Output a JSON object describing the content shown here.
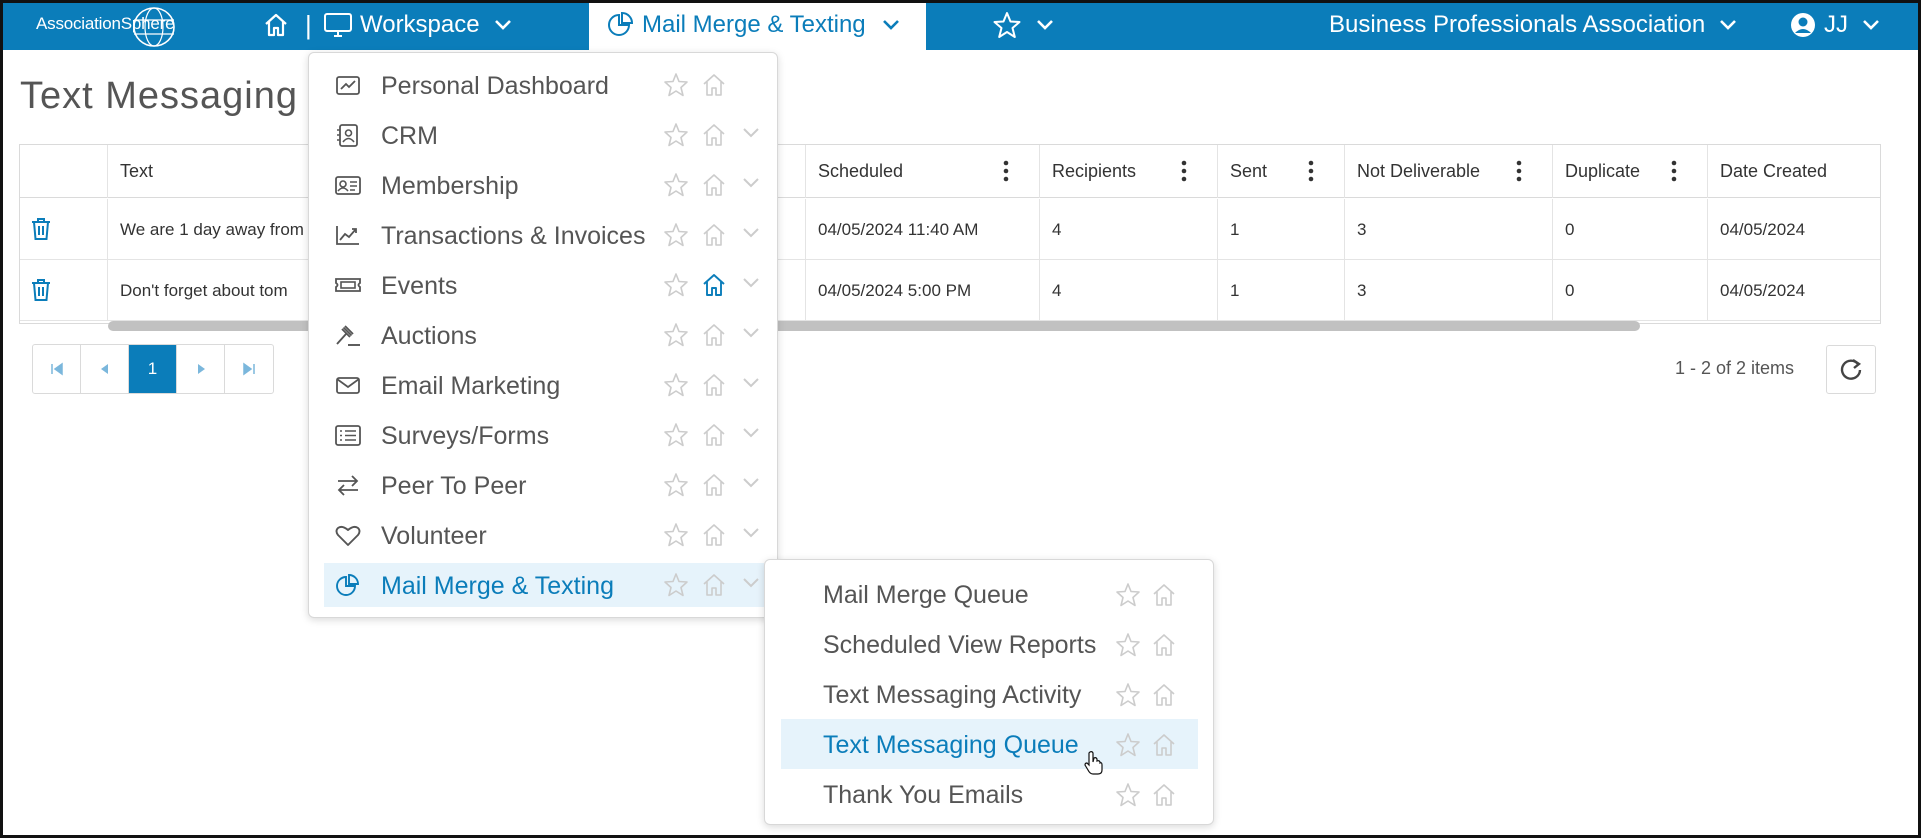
{
  "topbar": {
    "logo": "AssociationSphere",
    "separator": "|",
    "workspace_label": "Workspace",
    "active_menu_label": "Mail Merge & Texting",
    "org_name": "Business Professionals Association",
    "user_initials": "JJ",
    "brand_color": "#0b7dba"
  },
  "page": {
    "title": "Text Messaging"
  },
  "grid": {
    "columns": [
      "Text",
      "Scheduled",
      "Recipients",
      "Sent",
      "Not Deliverable",
      "Duplicate",
      "Date Created"
    ],
    "rows": [
      {
        "text": "We are 1 day away from",
        "scheduled": "04/05/2024 11:40 AM",
        "recipients": "4",
        "sent": "1",
        "not_deliverable": "3",
        "duplicate": "0",
        "date_created": "04/05/2024"
      },
      {
        "text": "Don't forget about tom",
        "scheduled": "04/05/2024 5:00 PM",
        "recipients": "4",
        "sent": "1",
        "not_deliverable": "3",
        "duplicate": "0",
        "date_created": "04/05/2024"
      }
    ]
  },
  "pager": {
    "current_page": "1",
    "items_info": "1 - 2 of 2 items"
  },
  "menu": {
    "items": [
      {
        "label": "Personal Dashboard",
        "icon": "dashboard-icon"
      },
      {
        "label": "CRM",
        "icon": "contact-card-icon"
      },
      {
        "label": "Membership",
        "icon": "id-card-icon"
      },
      {
        "label": "Transactions & Invoices",
        "icon": "trend-chart-icon"
      },
      {
        "label": "Events",
        "icon": "ticket-icon"
      },
      {
        "label": "Auctions",
        "icon": "gavel-icon"
      },
      {
        "label": "Email Marketing",
        "icon": "envelope-icon"
      },
      {
        "label": "Surveys/Forms",
        "icon": "list-icon"
      },
      {
        "label": "Peer To Peer",
        "icon": "arrows-exchange-icon"
      },
      {
        "label": "Volunteer",
        "icon": "heart-icon"
      },
      {
        "label": "Mail Merge & Texting",
        "icon": "pie-chart-icon"
      }
    ]
  },
  "submenu": {
    "items": [
      {
        "label": "Mail Merge Queue"
      },
      {
        "label": "Scheduled View Reports"
      },
      {
        "label": "Text Messaging Activity"
      },
      {
        "label": "Text Messaging Queue"
      },
      {
        "label": "Thank You Emails"
      }
    ]
  }
}
